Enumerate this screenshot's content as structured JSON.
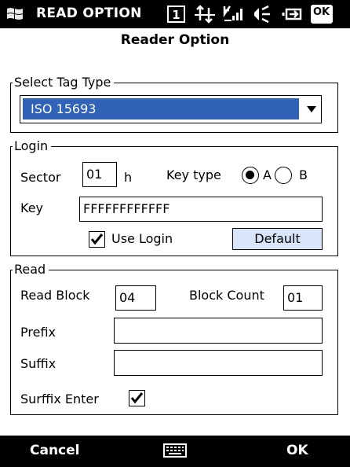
{
  "status_bar": {
    "title": "READ OPTION",
    "icons": [
      "windows-logo-icon",
      "sim-icon",
      "connectivity-icon",
      "signal-icon",
      "volume-icon",
      "battery-icon"
    ],
    "ok_label": "OK"
  },
  "heading": "Reader Option",
  "tag_type": {
    "legend": "Select Tag Type",
    "selected": "ISO 15693"
  },
  "login": {
    "legend": "Login",
    "sector_label": "Sector",
    "sector_value": "01",
    "sector_suffix": "h",
    "key_type_label": "Key type",
    "option_a": "A",
    "option_b": "B",
    "selected_key_type": "A",
    "key_label": "Key",
    "key_value": "FFFFFFFFFFFF",
    "use_login_label": "Use Login",
    "use_login_checked": true,
    "default_button": "Default"
  },
  "read": {
    "legend": "Read",
    "read_block_label": "Read Block",
    "read_block_value": "04",
    "block_count_label": "Block Count",
    "block_count_value": "01",
    "prefix_label": "Prefix",
    "prefix_value": "",
    "suffix_label": "Suffix",
    "suffix_value": "",
    "suffix_enter_label": "Surffix Enter",
    "suffix_enter_checked": true
  },
  "softkeys": {
    "left": "Cancel",
    "middle_icon": "keyboard-icon",
    "right": "OK"
  },
  "colors": {
    "selection": "#3063b8",
    "button_face": "#d8e4f8",
    "bar": "#000000"
  }
}
